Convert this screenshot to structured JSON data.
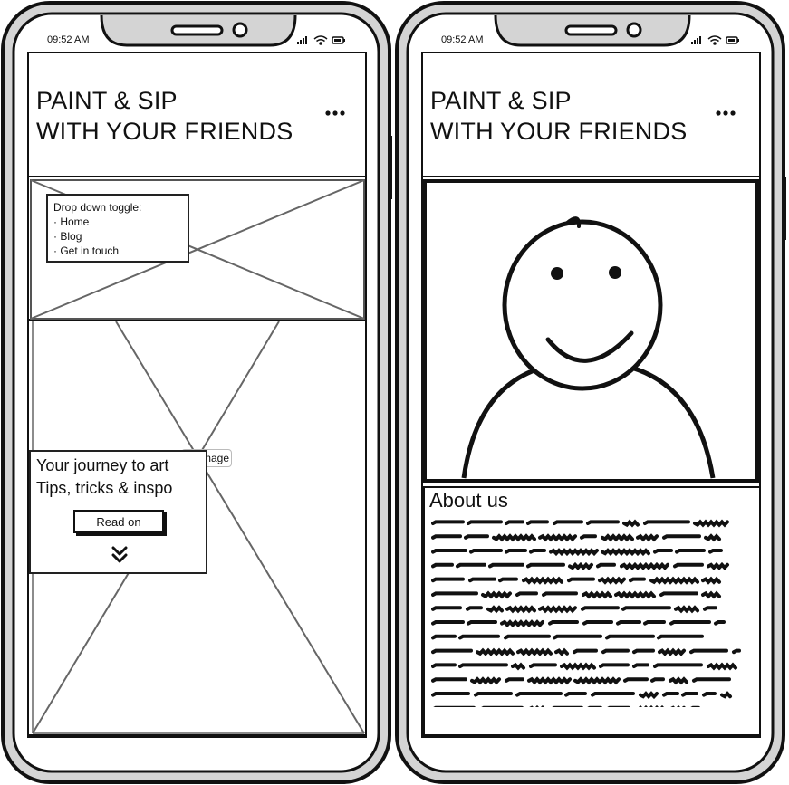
{
  "left_phone": {
    "status": {
      "time": "09:52 AM"
    },
    "header": {
      "title_line1": "PAINT & SIP",
      "title_line2": "WITH YOUR FRIENDS"
    },
    "dropdown_note": {
      "heading": "Drop down toggle:",
      "items": [
        "Home",
        "Blog",
        "Get in touch"
      ]
    },
    "image_label": "Image",
    "hero": {
      "line1": "Your journey to art",
      "line2": "Tips, tricks & inspo",
      "button_label": "Read on"
    }
  },
  "right_phone": {
    "status": {
      "time": "09:52 AM"
    },
    "header": {
      "title_line1": "PAINT & SIP",
      "title_line2": "WITH YOUR FRIENDS"
    },
    "about": {
      "title": "About us"
    }
  },
  "icons": [
    "signal-icon",
    "wifi-icon",
    "battery-icon",
    "menu-dots-icon",
    "double-chevron-down-icon",
    "avatar-placeholder-icon"
  ],
  "colors": {
    "frame_gray": "#d4d4d4",
    "stroke": "#111111",
    "placeholder_line": "#666666"
  }
}
